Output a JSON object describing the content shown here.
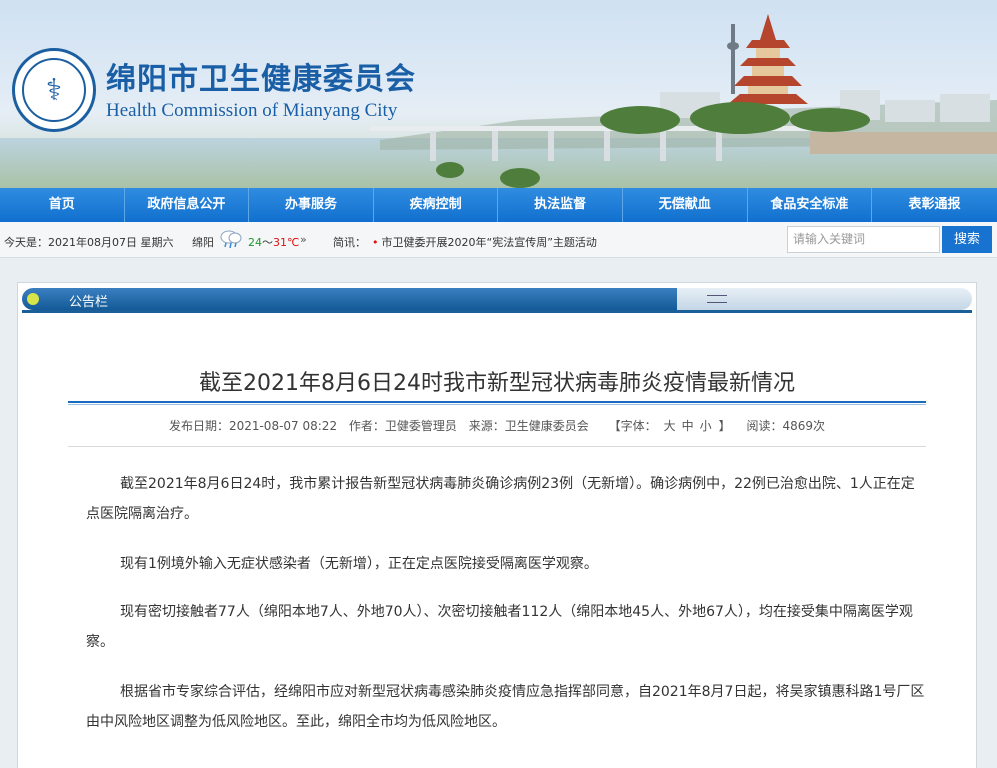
{
  "header": {
    "title": "绵阳市卫生健康委员会",
    "subtitle": "Health Commission of Mianyang City"
  },
  "nav": {
    "items": [
      "首页",
      "政府信息公开",
      "办事服务",
      "疾病控制",
      "执法监督",
      "无偿献血",
      "食品安全标准",
      "表彰通报"
    ]
  },
  "info": {
    "date": "今天是：2021年08月07日 星期六",
    "city": "绵阳",
    "temp_low": "24",
    "temp_sep": "～",
    "temp_high": "31℃",
    "arrows": "»",
    "notice_label": "简讯：",
    "notice_dot": "•",
    "notice_text": "市卫健委开展2020年“宪法宣传周”主题活动"
  },
  "search": {
    "placeholder": "请输入关键词",
    "button_label": "搜索"
  },
  "panel": {
    "label": "公告栏"
  },
  "article": {
    "title": "截至2021年8月6日24时我市新型冠状病毒肺炎疫情最新情况",
    "meta": {
      "publish": "发布日期：2021-08-07 08:22",
      "author": "作者：卫健委管理员",
      "source": "来源：卫生健康委员会",
      "font_label": "【字体：",
      "font_large": "大",
      "font_medium": "中",
      "font_small": "小",
      "font_close": "】",
      "views": "阅读：4869次"
    },
    "paragraphs": [
      "截至2021年8月6日24时，我市累计报告新型冠状病毒肺炎确诊病例23例（无新增）。确诊病例中，22例已治愈出院、1人正在定点医院隔离治疗。",
      "现有1例境外输入无症状感染者（无新增），正在定点医院接受隔离医学观察。",
      "现有密切接触者77人（绵阳本地7人、外地70人）、次密切接触者112人（绵阳本地45人、外地67人），均在接受集中隔离医学观察。",
      "根据省市专家综合评估，经绵阳市应对新型冠状病毒感染肺炎疫情应急指挥部同意，自2021年8月7日起，将吴家镇惠科路1号厂区由中风险地区调整为低风险地区。至此，绵阳全市均为低风险地区。"
    ]
  },
  "colors": {
    "brand_blue": "#1a5fa6",
    "nav_blue": "#1772d0",
    "accent_red": "#dd1111",
    "accent_green": "#1a9a2a"
  }
}
